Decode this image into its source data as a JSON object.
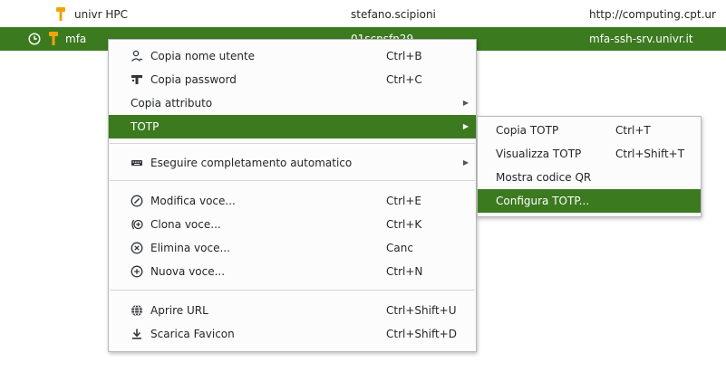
{
  "rows": [
    {
      "title": "univr HPC",
      "username": "stefano.scipioni",
      "url": "http://computing.cpt.ur"
    },
    {
      "title": "mfa",
      "username": "01scnsfn29",
      "url": "mfa-ssh-srv.univr.it"
    }
  ],
  "menu": {
    "copy_username": {
      "label": "Copia nome utente",
      "shortcut": "Ctrl+B"
    },
    "copy_password": {
      "label": "Copia password",
      "shortcut": "Ctrl+C"
    },
    "copy_attribute": {
      "label": "Copia attributo"
    },
    "totp": {
      "label": "TOTP"
    },
    "autotype": {
      "label": "Eseguire completamento automatico"
    },
    "edit_entry": {
      "label": "Modifica voce...",
      "shortcut": "Ctrl+E"
    },
    "clone_entry": {
      "label": "Clona voce...",
      "shortcut": "Ctrl+K"
    },
    "delete_entry": {
      "label": "Elimina voce...",
      "shortcut": "Canc"
    },
    "new_entry": {
      "label": "Nuova voce...",
      "shortcut": "Ctrl+N"
    },
    "open_url": {
      "label": "Aprire URL",
      "shortcut": "Ctrl+Shift+U"
    },
    "download_favicon": {
      "label": "Scarica Favicon",
      "shortcut": "Ctrl+Shift+D"
    }
  },
  "submenu": {
    "copy_totp": {
      "label": "Copia TOTP",
      "shortcut": "Ctrl+T"
    },
    "show_totp": {
      "label": "Visualizza TOTP",
      "shortcut": "Ctrl+Shift+T"
    },
    "show_qr": {
      "label": "Mostra codice QR"
    },
    "setup_totp": {
      "label": "Configura TOTP..."
    }
  },
  "colors": {
    "highlight": "#3c7a1f",
    "key_icon": "#f0a30a"
  }
}
